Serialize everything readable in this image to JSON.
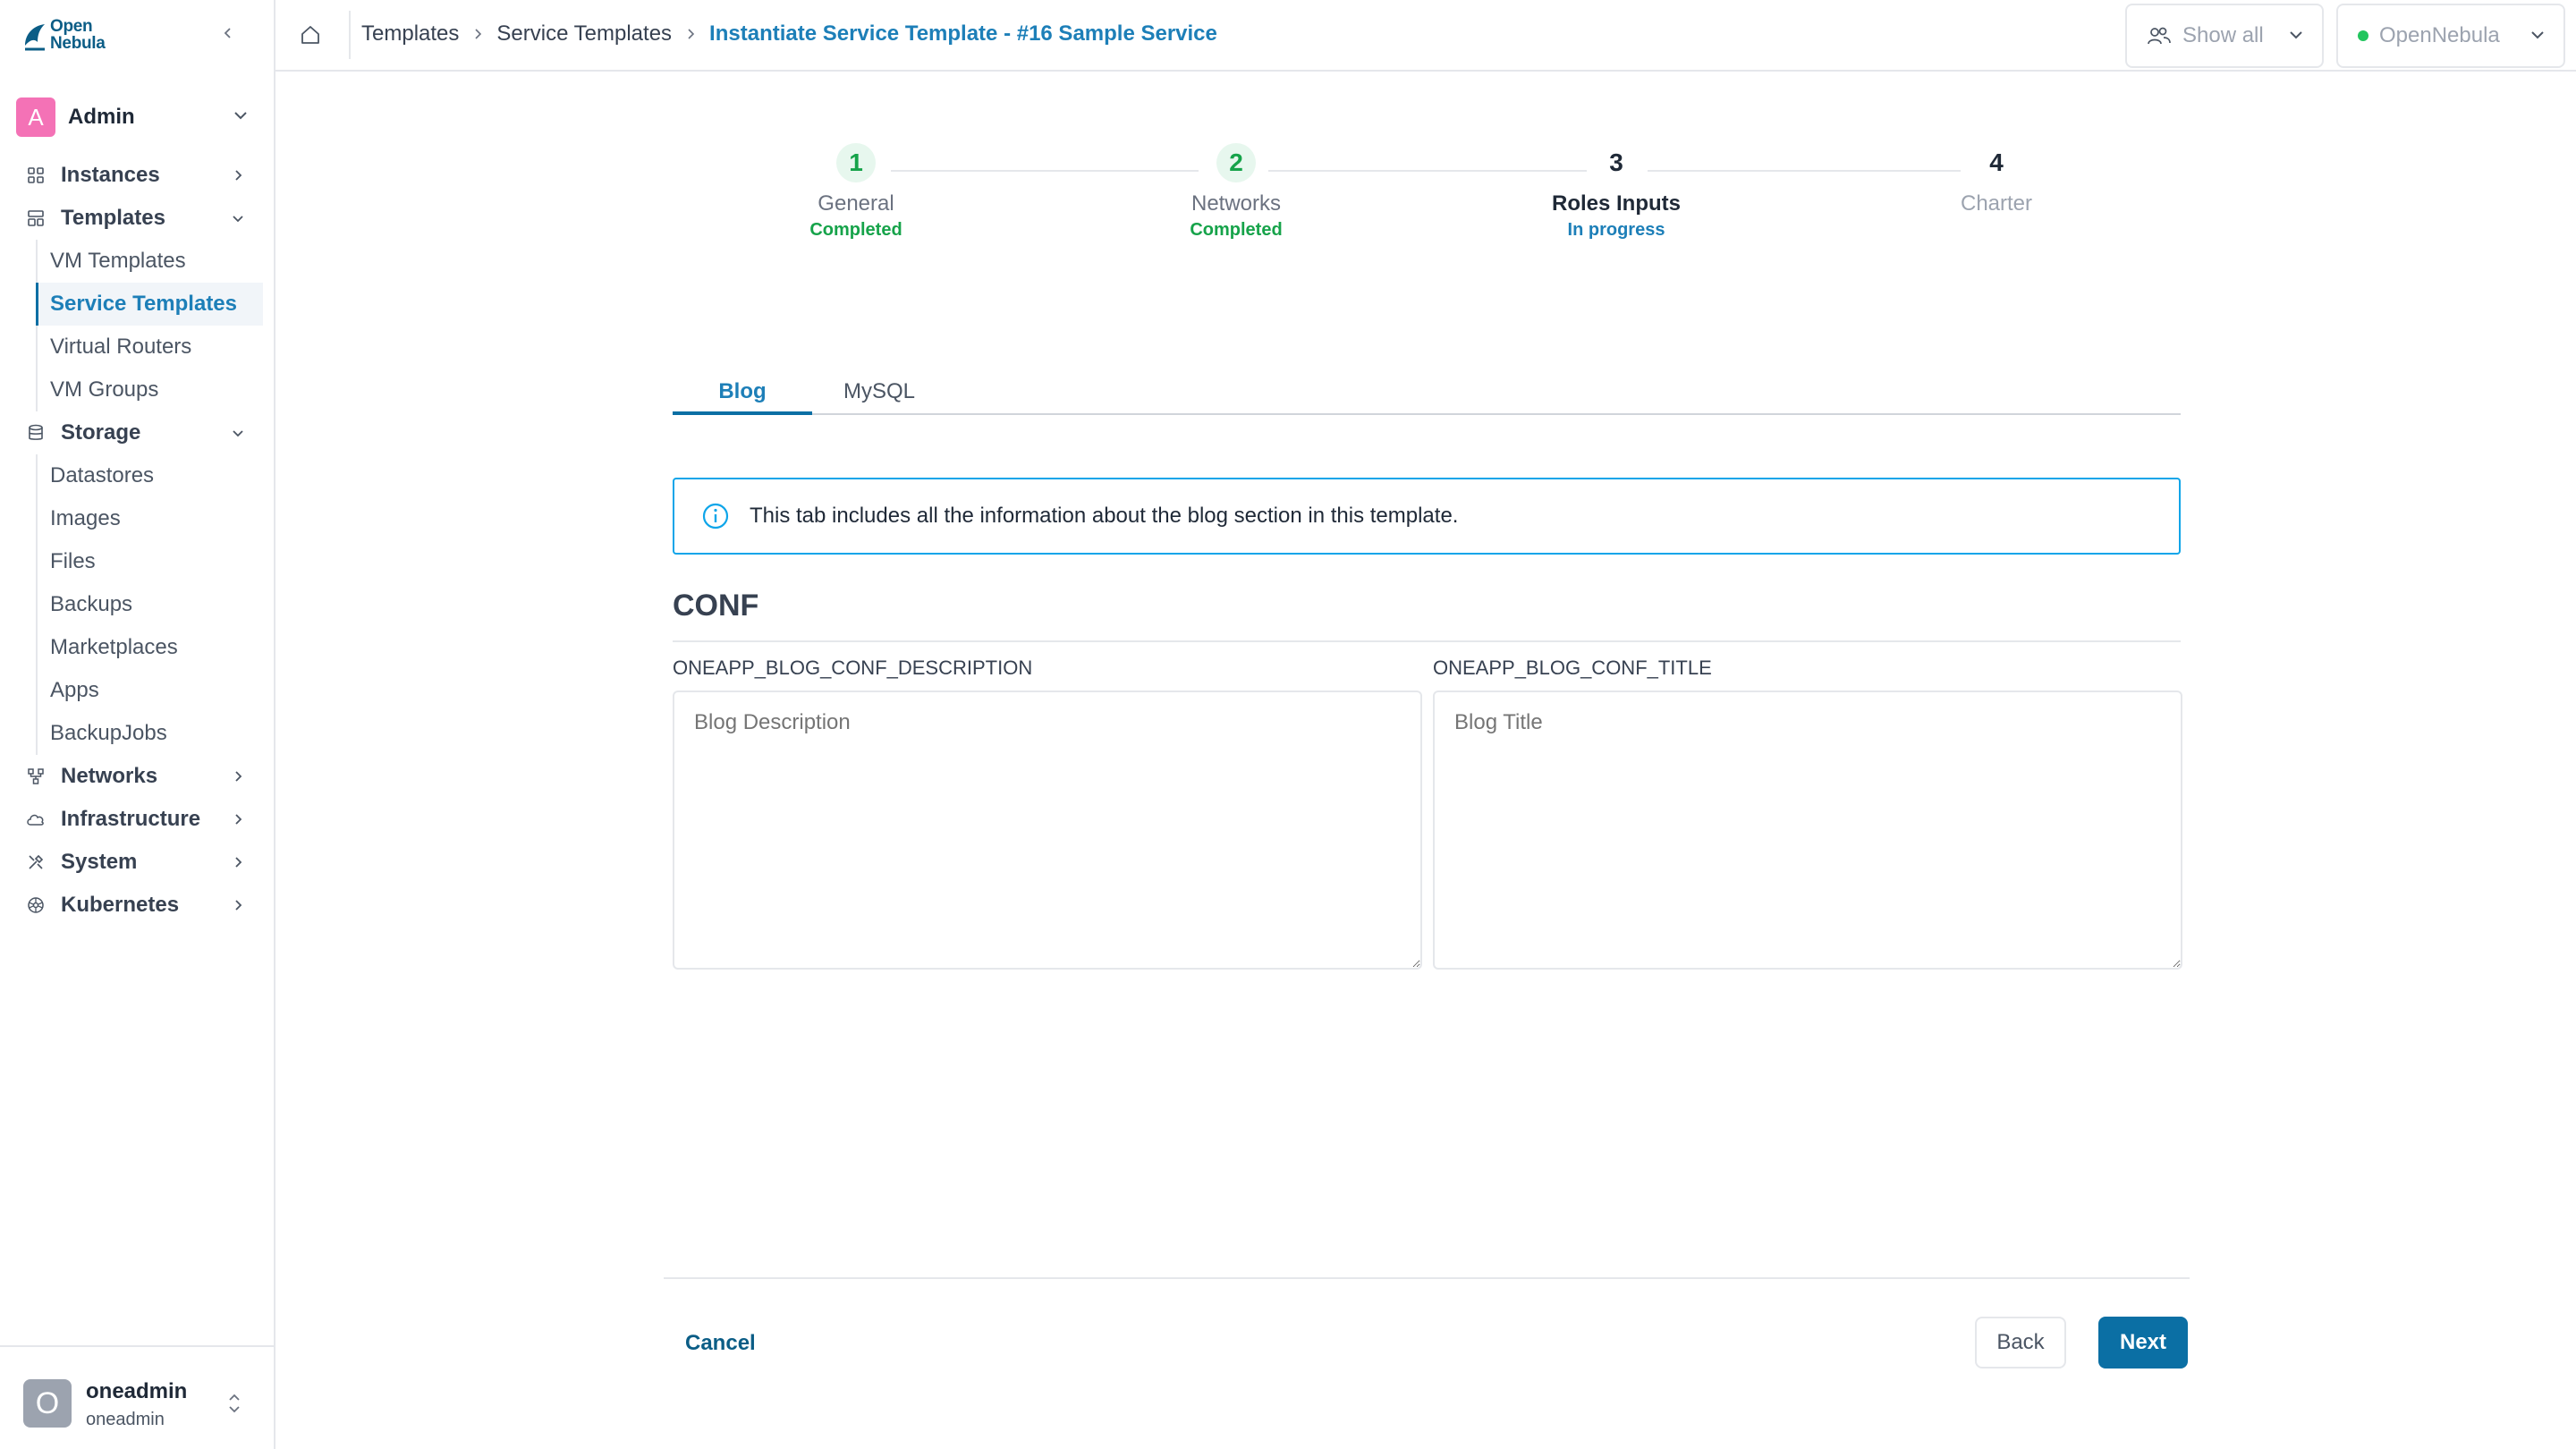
{
  "app": {
    "logo_text_line1": "Open",
    "logo_text_line2": "Nebula"
  },
  "sidebar": {
    "group_label": "Admin",
    "group_avatar": "A",
    "nav": [
      {
        "label": "Instances",
        "icon": "grid-icon"
      },
      {
        "label": "Templates",
        "icon": "templates-icon"
      }
    ],
    "templates_sub": [
      "VM Templates",
      "Service Templates",
      "Virtual Routers",
      "VM Groups"
    ],
    "storage_label": "Storage",
    "storage_sub": [
      "Datastores",
      "Images",
      "Files",
      "Backups",
      "Marketplaces",
      "Apps",
      "BackupJobs"
    ],
    "nav_bottom": [
      {
        "label": "Networks",
        "icon": "network-icon"
      },
      {
        "label": "Infrastructure",
        "icon": "cloud-icon"
      },
      {
        "label": "System",
        "icon": "tools-icon"
      },
      {
        "label": "Kubernetes",
        "icon": "kubernetes-icon"
      }
    ],
    "user": {
      "avatar": "O",
      "name": "oneadmin",
      "group": "oneadmin"
    }
  },
  "topbar": {
    "breadcrumb": [
      "Templates",
      "Service Templates",
      "Instantiate Service Template - #16 Sample Service"
    ],
    "show_all": "Show all",
    "zone": "OpenNebula",
    "zone_status_color": "#22c55e"
  },
  "stepper": [
    {
      "num": "1",
      "label": "General",
      "status": "Completed"
    },
    {
      "num": "2",
      "label": "Networks",
      "status": "Completed"
    },
    {
      "num": "3",
      "label": "Roles Inputs",
      "status": "In progress"
    },
    {
      "num": "4",
      "label": "Charter",
      "status": ""
    }
  ],
  "tabs": [
    "Blog",
    "MySQL"
  ],
  "info": "This tab includes all the information about the blog section in this template.",
  "section": {
    "title": "CONF",
    "fields": [
      {
        "label": "ONEAPP_BLOG_CONF_DESCRIPTION",
        "placeholder": "Blog Description"
      },
      {
        "label": "ONEAPP_BLOG_CONF_TITLE",
        "placeholder": "Blog Title"
      }
    ]
  },
  "footer": {
    "cancel": "Cancel",
    "back": "Back",
    "next": "Next"
  },
  "colors": {
    "accent": "#0b6fa4",
    "link": "#1d7fb8",
    "success": "#16a34a",
    "info_border": "#0ea5e9"
  }
}
